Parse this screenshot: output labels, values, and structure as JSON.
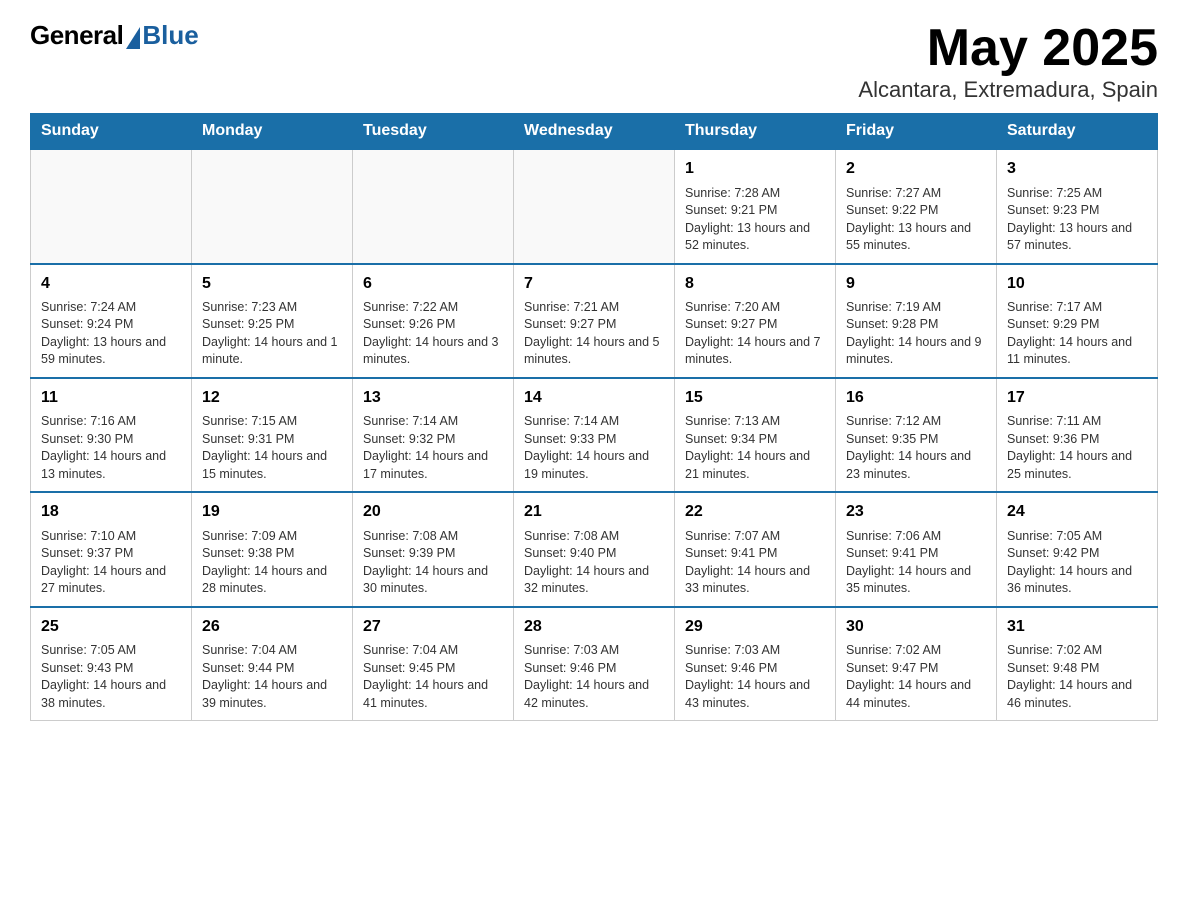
{
  "logo": {
    "general": "General",
    "blue": "Blue"
  },
  "header": {
    "month_year": "May 2025",
    "location": "Alcantara, Extremadura, Spain"
  },
  "weekdays": [
    "Sunday",
    "Monday",
    "Tuesday",
    "Wednesday",
    "Thursday",
    "Friday",
    "Saturday"
  ],
  "weeks": [
    [
      {
        "day": "",
        "info": ""
      },
      {
        "day": "",
        "info": ""
      },
      {
        "day": "",
        "info": ""
      },
      {
        "day": "",
        "info": ""
      },
      {
        "day": "1",
        "info": "Sunrise: 7:28 AM\nSunset: 9:21 PM\nDaylight: 13 hours and 52 minutes."
      },
      {
        "day": "2",
        "info": "Sunrise: 7:27 AM\nSunset: 9:22 PM\nDaylight: 13 hours and 55 minutes."
      },
      {
        "day": "3",
        "info": "Sunrise: 7:25 AM\nSunset: 9:23 PM\nDaylight: 13 hours and 57 minutes."
      }
    ],
    [
      {
        "day": "4",
        "info": "Sunrise: 7:24 AM\nSunset: 9:24 PM\nDaylight: 13 hours and 59 minutes."
      },
      {
        "day": "5",
        "info": "Sunrise: 7:23 AM\nSunset: 9:25 PM\nDaylight: 14 hours and 1 minute."
      },
      {
        "day": "6",
        "info": "Sunrise: 7:22 AM\nSunset: 9:26 PM\nDaylight: 14 hours and 3 minutes."
      },
      {
        "day": "7",
        "info": "Sunrise: 7:21 AM\nSunset: 9:27 PM\nDaylight: 14 hours and 5 minutes."
      },
      {
        "day": "8",
        "info": "Sunrise: 7:20 AM\nSunset: 9:27 PM\nDaylight: 14 hours and 7 minutes."
      },
      {
        "day": "9",
        "info": "Sunrise: 7:19 AM\nSunset: 9:28 PM\nDaylight: 14 hours and 9 minutes."
      },
      {
        "day": "10",
        "info": "Sunrise: 7:17 AM\nSunset: 9:29 PM\nDaylight: 14 hours and 11 minutes."
      }
    ],
    [
      {
        "day": "11",
        "info": "Sunrise: 7:16 AM\nSunset: 9:30 PM\nDaylight: 14 hours and 13 minutes."
      },
      {
        "day": "12",
        "info": "Sunrise: 7:15 AM\nSunset: 9:31 PM\nDaylight: 14 hours and 15 minutes."
      },
      {
        "day": "13",
        "info": "Sunrise: 7:14 AM\nSunset: 9:32 PM\nDaylight: 14 hours and 17 minutes."
      },
      {
        "day": "14",
        "info": "Sunrise: 7:14 AM\nSunset: 9:33 PM\nDaylight: 14 hours and 19 minutes."
      },
      {
        "day": "15",
        "info": "Sunrise: 7:13 AM\nSunset: 9:34 PM\nDaylight: 14 hours and 21 minutes."
      },
      {
        "day": "16",
        "info": "Sunrise: 7:12 AM\nSunset: 9:35 PM\nDaylight: 14 hours and 23 minutes."
      },
      {
        "day": "17",
        "info": "Sunrise: 7:11 AM\nSunset: 9:36 PM\nDaylight: 14 hours and 25 minutes."
      }
    ],
    [
      {
        "day": "18",
        "info": "Sunrise: 7:10 AM\nSunset: 9:37 PM\nDaylight: 14 hours and 27 minutes."
      },
      {
        "day": "19",
        "info": "Sunrise: 7:09 AM\nSunset: 9:38 PM\nDaylight: 14 hours and 28 minutes."
      },
      {
        "day": "20",
        "info": "Sunrise: 7:08 AM\nSunset: 9:39 PM\nDaylight: 14 hours and 30 minutes."
      },
      {
        "day": "21",
        "info": "Sunrise: 7:08 AM\nSunset: 9:40 PM\nDaylight: 14 hours and 32 minutes."
      },
      {
        "day": "22",
        "info": "Sunrise: 7:07 AM\nSunset: 9:41 PM\nDaylight: 14 hours and 33 minutes."
      },
      {
        "day": "23",
        "info": "Sunrise: 7:06 AM\nSunset: 9:41 PM\nDaylight: 14 hours and 35 minutes."
      },
      {
        "day": "24",
        "info": "Sunrise: 7:05 AM\nSunset: 9:42 PM\nDaylight: 14 hours and 36 minutes."
      }
    ],
    [
      {
        "day": "25",
        "info": "Sunrise: 7:05 AM\nSunset: 9:43 PM\nDaylight: 14 hours and 38 minutes."
      },
      {
        "day": "26",
        "info": "Sunrise: 7:04 AM\nSunset: 9:44 PM\nDaylight: 14 hours and 39 minutes."
      },
      {
        "day": "27",
        "info": "Sunrise: 7:04 AM\nSunset: 9:45 PM\nDaylight: 14 hours and 41 minutes."
      },
      {
        "day": "28",
        "info": "Sunrise: 7:03 AM\nSunset: 9:46 PM\nDaylight: 14 hours and 42 minutes."
      },
      {
        "day": "29",
        "info": "Sunrise: 7:03 AM\nSunset: 9:46 PM\nDaylight: 14 hours and 43 minutes."
      },
      {
        "day": "30",
        "info": "Sunrise: 7:02 AM\nSunset: 9:47 PM\nDaylight: 14 hours and 44 minutes."
      },
      {
        "day": "31",
        "info": "Sunrise: 7:02 AM\nSunset: 9:48 PM\nDaylight: 14 hours and 46 minutes."
      }
    ]
  ]
}
